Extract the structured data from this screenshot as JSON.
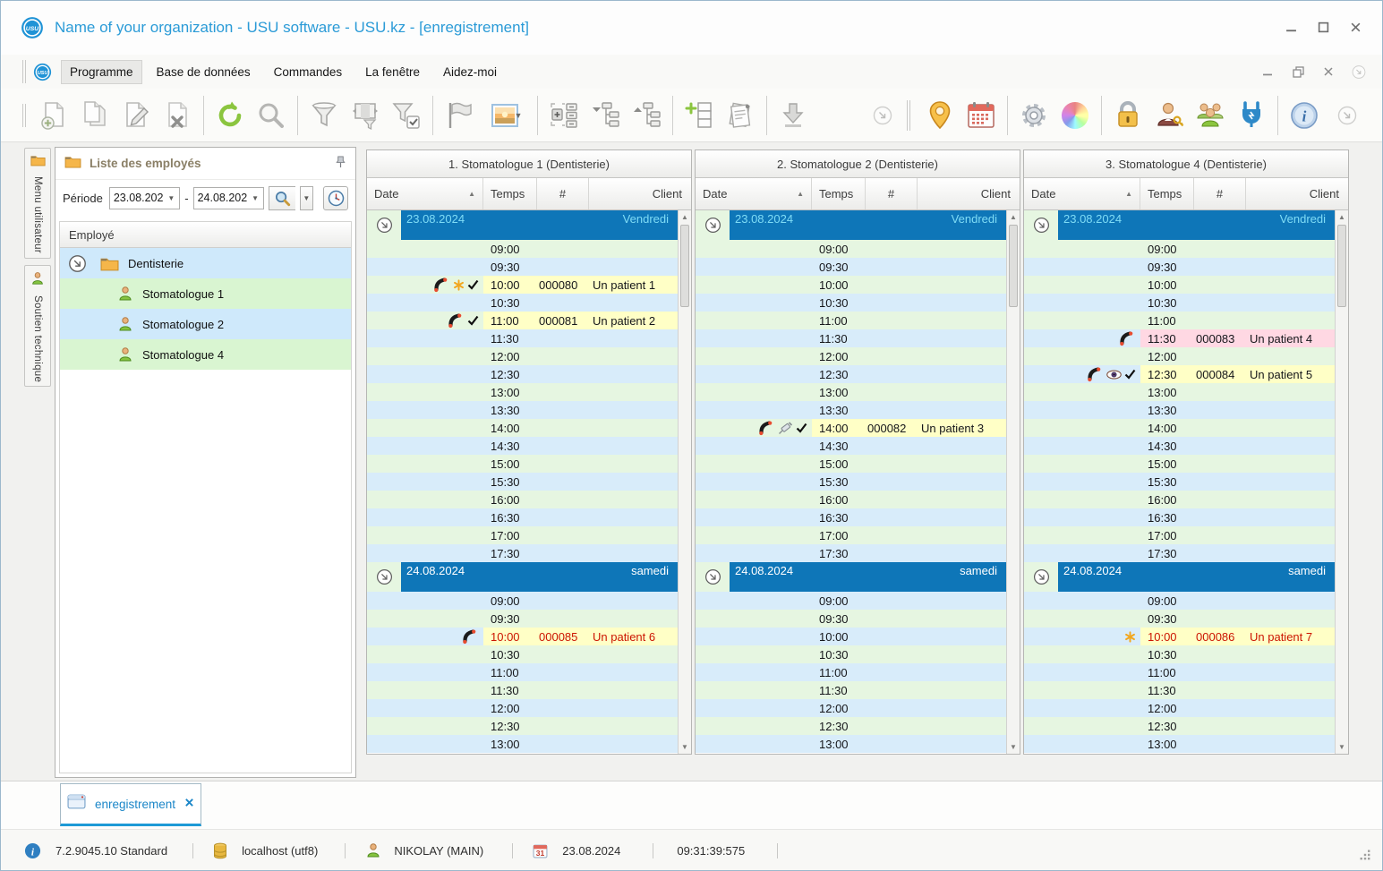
{
  "titlebar": {
    "title": "Name of your organization - USU software - USU.kz - [enregistrement]"
  },
  "menu": {
    "items": [
      "Programme",
      "Base de données",
      "Commandes",
      "La fenêtre",
      "Aidez-moi"
    ],
    "active": "Programme"
  },
  "toolbar": {
    "icons": [
      "new-document",
      "copy-document",
      "edit-document",
      "delete-document",
      "refresh",
      "search",
      "filter",
      "filter-columns",
      "filter-apply",
      "flag",
      "image-preview",
      "expand-rows",
      "expand-tree",
      "collapse-tree",
      "add-row",
      "reports",
      "download",
      "scroll-down",
      "location",
      "calendar",
      "settings",
      "color-scheme",
      "lock",
      "user-permissions",
      "user-groups",
      "plugins",
      "info",
      "scroll-down"
    ]
  },
  "sidebar": {
    "tabs": [
      {
        "label": "Menu utilisateur",
        "icon": "folder"
      },
      {
        "label": "Soutien technique",
        "icon": "person"
      }
    ],
    "panel_title": "Liste des employés",
    "period": {
      "label": "Période",
      "from": "23.08.202",
      "to": "24.08.202",
      "separator": "-"
    },
    "employee_header": "Employé",
    "tree": {
      "root": "Dentisterie",
      "children": [
        "Stomatologue 1",
        "Stomatologue 2",
        "Stomatologue 4"
      ]
    }
  },
  "schedule": {
    "columns": {
      "date": "Date",
      "time": "Temps",
      "number": "#",
      "client": "Client"
    },
    "days": [
      {
        "date": "23.08.2024",
        "weekday": "Vendredi",
        "times": "friday"
      },
      {
        "date": "24.08.2024",
        "weekday": "samedi",
        "times": "saturday"
      }
    ],
    "times": {
      "friday": [
        "09:00",
        "09:30",
        "10:00",
        "10:30",
        "11:00",
        "11:30",
        "12:00",
        "12:30",
        "13:00",
        "13:30",
        "14:00",
        "14:30",
        "15:00",
        "15:30",
        "16:00",
        "16:30",
        "17:00",
        "17:30"
      ],
      "saturday": [
        "09:00",
        "09:30",
        "10:00",
        "10:30",
        "11:00",
        "11:30",
        "12:00",
        "12:30",
        "13:00"
      ]
    },
    "panels": [
      {
        "title": "1. Stomatologue 1 (Dentisterie)",
        "appointments": [
          {
            "day": 0,
            "time": "10:00",
            "number": "000080",
            "client": "Un patient 1",
            "highlight": "yellow",
            "text": "dark",
            "icons": [
              "phone",
              "star",
              "check"
            ]
          },
          {
            "day": 0,
            "time": "11:00",
            "number": "000081",
            "client": "Un patient 2",
            "highlight": "yellow",
            "text": "dark",
            "icons": [
              "phone",
              "check"
            ]
          },
          {
            "day": 1,
            "time": "10:00",
            "number": "000085",
            "client": "Un patient 6",
            "highlight": "yellow",
            "text": "red",
            "icons": [
              "phone"
            ]
          }
        ]
      },
      {
        "title": "2. Stomatologue 2 (Dentisterie)",
        "appointments": [
          {
            "day": 0,
            "time": "14:00",
            "number": "000082",
            "client": "Un patient 3",
            "highlight": "yellow",
            "text": "dark",
            "icons": [
              "phone",
              "syringe",
              "check"
            ]
          }
        ]
      },
      {
        "title": "3. Stomatologue 4 (Dentisterie)",
        "appointments": [
          {
            "day": 0,
            "time": "11:30",
            "number": "000083",
            "client": "Un patient 4",
            "highlight": "pink",
            "text": "dark",
            "icons": [
              "phone"
            ]
          },
          {
            "day": 0,
            "time": "12:30",
            "number": "000084",
            "client": "Un patient 5",
            "highlight": "yellow",
            "text": "dark",
            "icons": [
              "phone",
              "eye",
              "check"
            ]
          },
          {
            "day": 1,
            "time": "10:00",
            "number": "000086",
            "client": "Un patient 7",
            "highlight": "yellow",
            "text": "red",
            "icons": [
              "star"
            ]
          }
        ]
      }
    ]
  },
  "footer": {
    "tab": {
      "label": "enregistrement"
    },
    "status": [
      {
        "icon": "info",
        "text": "7.2.9045.10 Standard"
      },
      {
        "icon": "database",
        "text": "localhost (utf8)"
      },
      {
        "icon": "user",
        "text": "NIKOLAY (MAIN)"
      },
      {
        "icon": "calendar",
        "text": "23.08.2024"
      },
      {
        "icon": "none",
        "text": "09:31:39:575"
      }
    ]
  },
  "colors": {
    "accent_blue": "#1c97d4",
    "band_blue": "#0e76b8",
    "row_green": "#e6f6e1",
    "row_blue": "#d8ecfa",
    "appt_yellow": "#ffffc6",
    "appt_pink": "#ffd8e3",
    "appt_red_text": "#cc1500"
  }
}
